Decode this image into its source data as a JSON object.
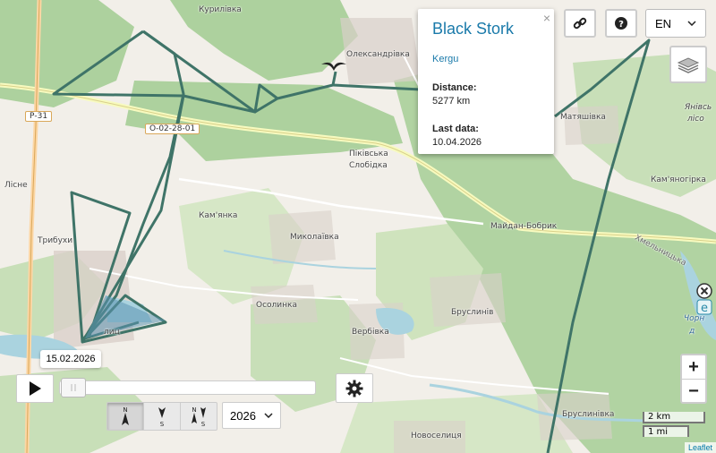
{
  "popup": {
    "title": "Black Stork",
    "name": "Kergu",
    "distance_label": "Distance:",
    "distance_value": "5277 km",
    "last_data_label": "Last data:",
    "last_data_value": "10.04.2026",
    "close_symbol": "×"
  },
  "map_labels": {
    "kurylivka": "Курилівка",
    "oleksandrivka": "Олександрівка",
    "liisne": "Лісне",
    "pykivska": "Піківська",
    "slobidka": "Слобідка",
    "kamianka": "Кам'янка",
    "tryukhy": "Трибухи",
    "mykolaivka": "Миколаївка",
    "maidan_bobryk": "Майдан-Бобрик",
    "matiashivka": "Матяшівка",
    "kamianohirka": "Кам'яногірка",
    "yanivske": "Янівсь",
    "yanivske2": "лісо",
    "osolynka": "Осолинка",
    "bruslyniv": "Бруслинів",
    "verbivka": "Вербівка",
    "brusylynivka": "Бруслинівка",
    "novoselytsia": "Новоселиця",
    "khmelnytska": "Хмельницька",
    "chorna1": "Чорн",
    "chorna2": "д",
    "town": "лиц"
  },
  "roads": {
    "p31": "Р-31",
    "o022801": "О-02-28-01"
  },
  "controls": {
    "language": "EN",
    "date_tooltip": "15.02.2026",
    "year": "2026",
    "zoom_in": "+",
    "zoom_out": "−",
    "scale_km": "2 km",
    "scale_mi": "1 mi",
    "attribution": "Leaflet",
    "orientation_labels": [
      "N",
      "S",
      "N",
      "S"
    ]
  },
  "icons": {
    "link": "link-icon",
    "help": "question-icon",
    "layers": "layers-icon",
    "play": "play-icon",
    "settings": "gear-icon",
    "bird": "bird-icon"
  },
  "colors": {
    "track": "#3f7468",
    "forest": "#add19e",
    "popup_title": "#1a7aaa"
  }
}
